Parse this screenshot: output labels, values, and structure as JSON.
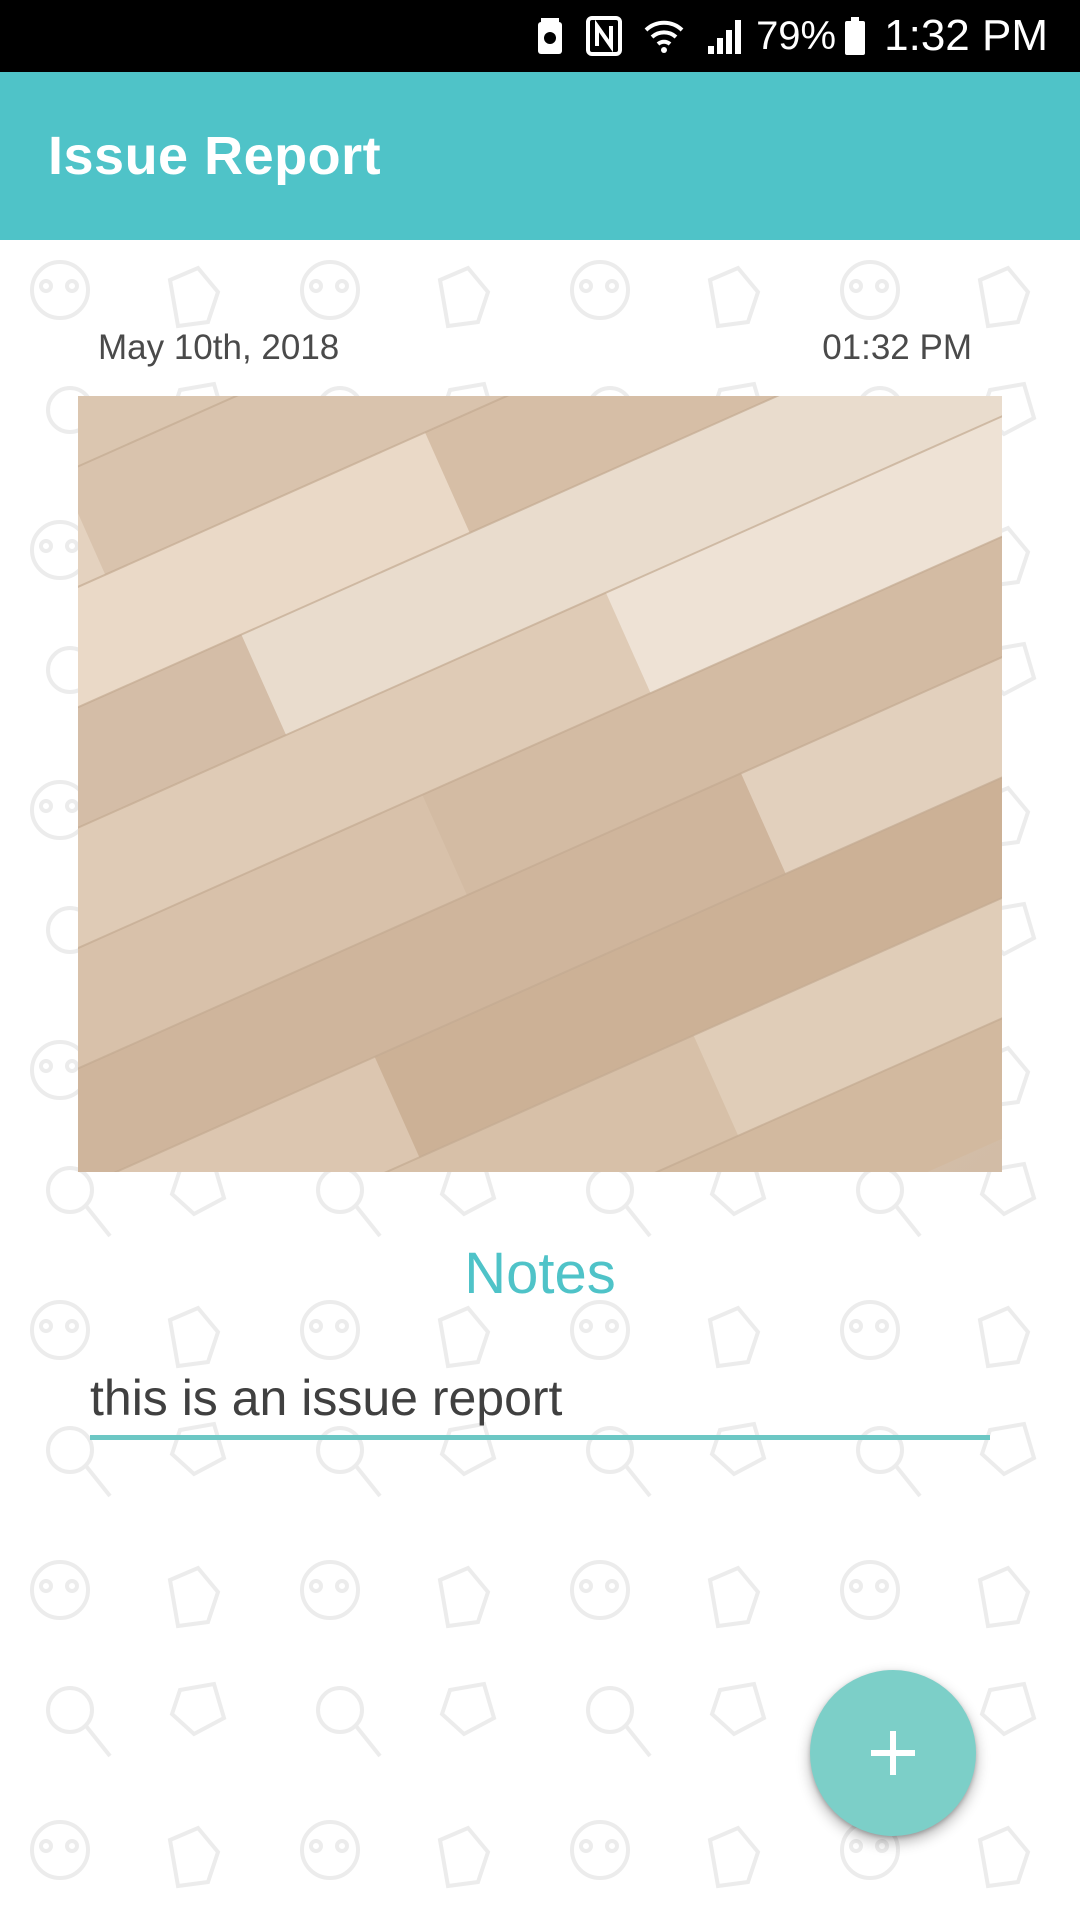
{
  "status_bar": {
    "battery_percent": "79%",
    "time": "1:32 PM",
    "icons": [
      "battery-saver-icon",
      "nfc-icon",
      "wifi-icon",
      "cell-signal-icon",
      "battery-icon"
    ]
  },
  "app_bar": {
    "title": "Issue Report",
    "color": "#4fc3c8"
  },
  "report": {
    "date": "May 10th, 2018",
    "time": "01:32 PM",
    "photo_icon": "photo-wood-floor"
  },
  "notes": {
    "heading": "Notes",
    "value": "this is an issue report",
    "accent_color": "#6cc7c4"
  },
  "fab": {
    "icon": "plus-icon",
    "color": "#7ccfc8"
  }
}
